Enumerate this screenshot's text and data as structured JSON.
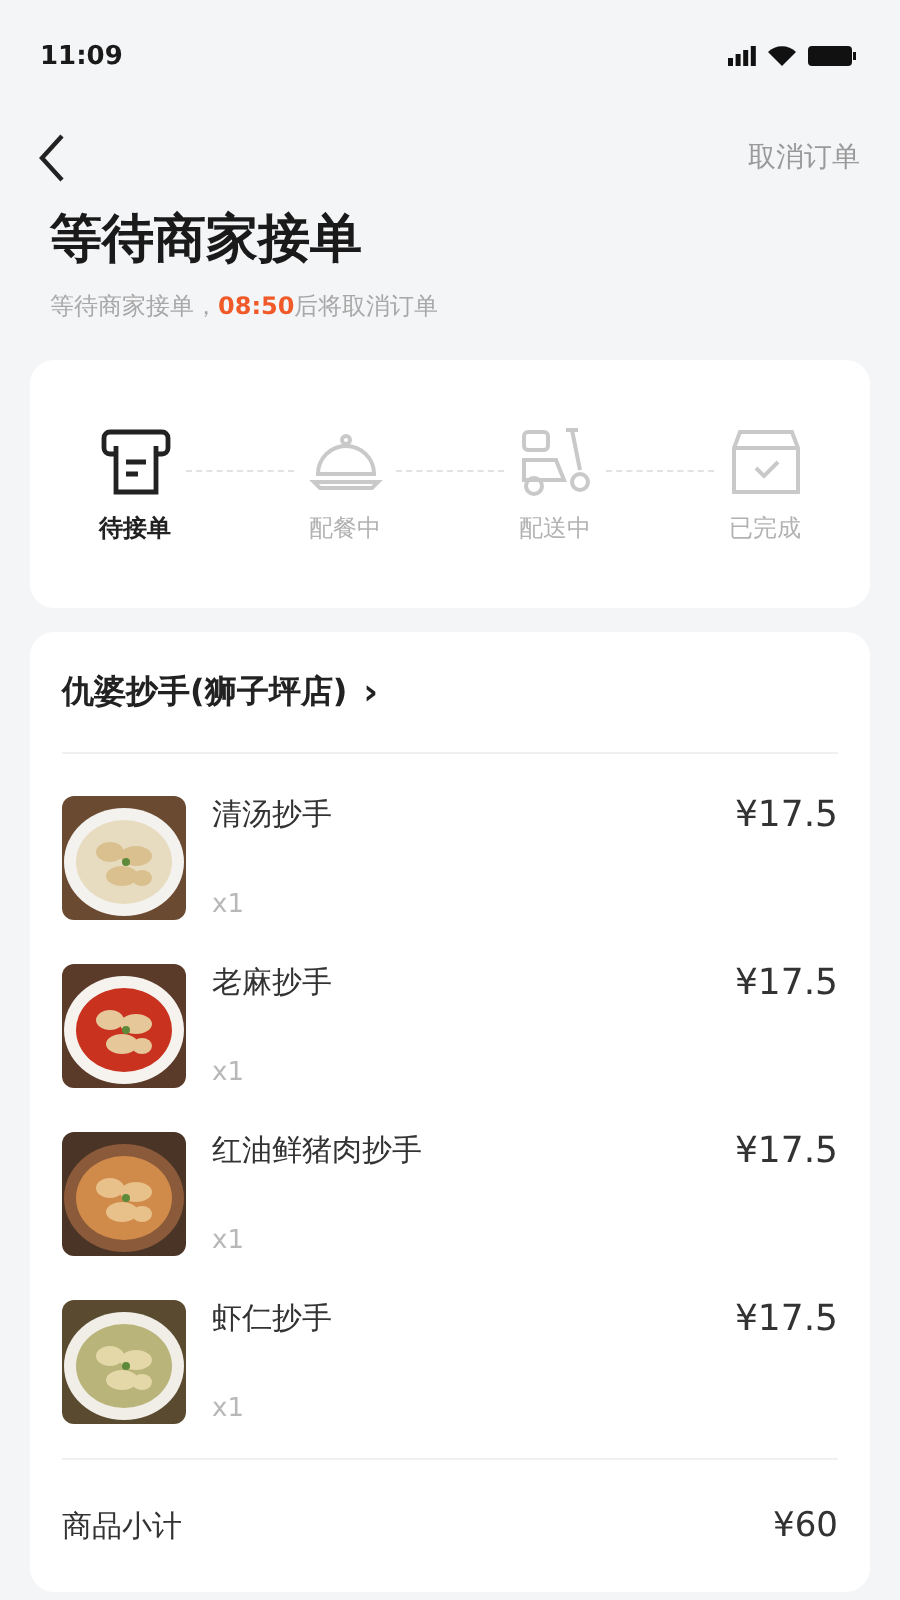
{
  "status_bar": {
    "time": "11:09"
  },
  "nav": {
    "action": "取消订单"
  },
  "header": {
    "title": "等待商家接单",
    "subtitle": "等待商家接单，**08:50**后将取消订单"
  },
  "steps": [
    {
      "kind": "receipt",
      "label": "待接单",
      "active": true
    },
    {
      "kind": "cloche",
      "label": "配餐中",
      "active": false
    },
    {
      "kind": "scooter",
      "label": "配送中",
      "active": false
    },
    {
      "kind": "box",
      "label": "已完成",
      "active": false
    }
  ],
  "shop": {
    "name": "仇婆抄手(狮子坪店)",
    "arrow": "›"
  },
  "items": [
    {
      "name": "清汤抄手",
      "qty": "x1",
      "price": "¥17.5",
      "kind": "picture"
    },
    {
      "name": "老麻抄手",
      "qty": "x1",
      "price": "¥17.5",
      "kind": "picture"
    },
    {
      "name": "红油鲜猪肉抄手",
      "qty": "x1",
      "price": "¥17.5",
      "kind": "picture"
    },
    {
      "name": "虾仁抄手",
      "qty": "x1",
      "price": "¥17.5",
      "kind": "picture"
    }
  ],
  "subtotal": {
    "label": "商品小计",
    "value": "¥60"
  }
}
